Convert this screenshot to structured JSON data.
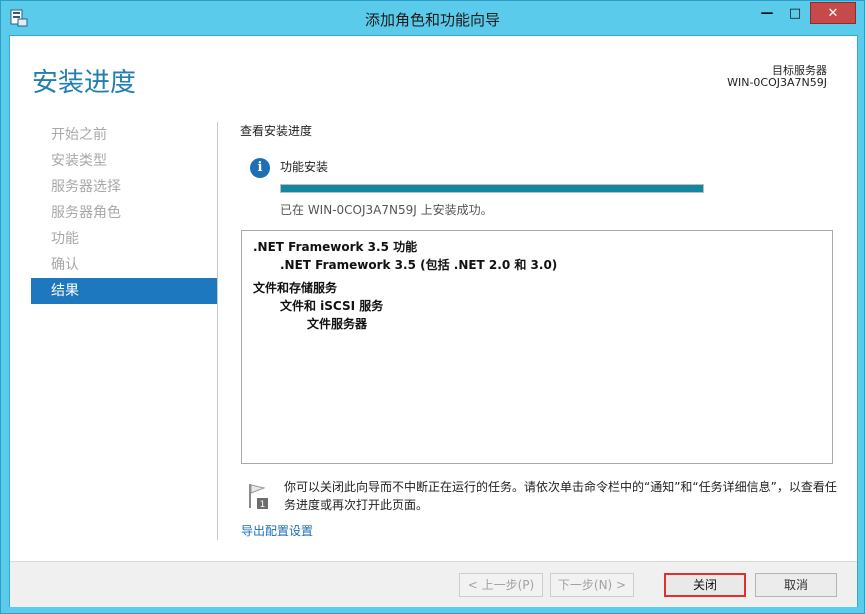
{
  "window": {
    "title": "添加角色和功能向导",
    "controls": {
      "minimize": "—",
      "maximize": "□",
      "close": "✕"
    }
  },
  "header": {
    "page_title": "安装进度",
    "destination_label": "目标服务器",
    "destination_server": "WIN-0COJ3A7N59J"
  },
  "sidebar": {
    "items": [
      {
        "label": "开始之前",
        "active": false
      },
      {
        "label": "安装类型",
        "active": false
      },
      {
        "label": "服务器选择",
        "active": false
      },
      {
        "label": "服务器角色",
        "active": false
      },
      {
        "label": "功能",
        "active": false
      },
      {
        "label": "确认",
        "active": false
      },
      {
        "label": "结果",
        "active": true
      }
    ]
  },
  "main": {
    "section_label": "查看安装进度",
    "feature_label": "功能安装",
    "progress": 1.0,
    "status": "已在 WIN-0COJ3A7N59J 上安装成功。",
    "results": [
      {
        "text": ".NET Framework 3.5 功能",
        "level": 0
      },
      {
        "text": ".NET Framework 3.5 (包括 .NET 2.0 和 3.0)",
        "level": 1
      },
      {
        "text": "文件和存储服务",
        "level": 0
      },
      {
        "text": "文件和 iSCSI 服务",
        "level": 1
      },
      {
        "text": "文件服务器",
        "level": 2
      }
    ],
    "note": "你可以关闭此向导而不中断正在运行的任务。请依次单击命令栏中的“通知”和“任务详细信息”，以查看任务进度或再次打开此页面。",
    "export_link": "导出配置设置"
  },
  "footer": {
    "prev": "< 上一步(P)",
    "next": "下一步(N) >",
    "close": "关闭",
    "cancel": "取消"
  },
  "colors": {
    "accent": "#1f7fae",
    "nav_active": "#1e78bf",
    "progress_fill": "#15869f",
    "highlight_border": "#e03131",
    "window_frame": "#5bcbec"
  },
  "icons": {
    "app": "server-manager-icon",
    "info": "info-icon",
    "note": "flag-icon"
  }
}
